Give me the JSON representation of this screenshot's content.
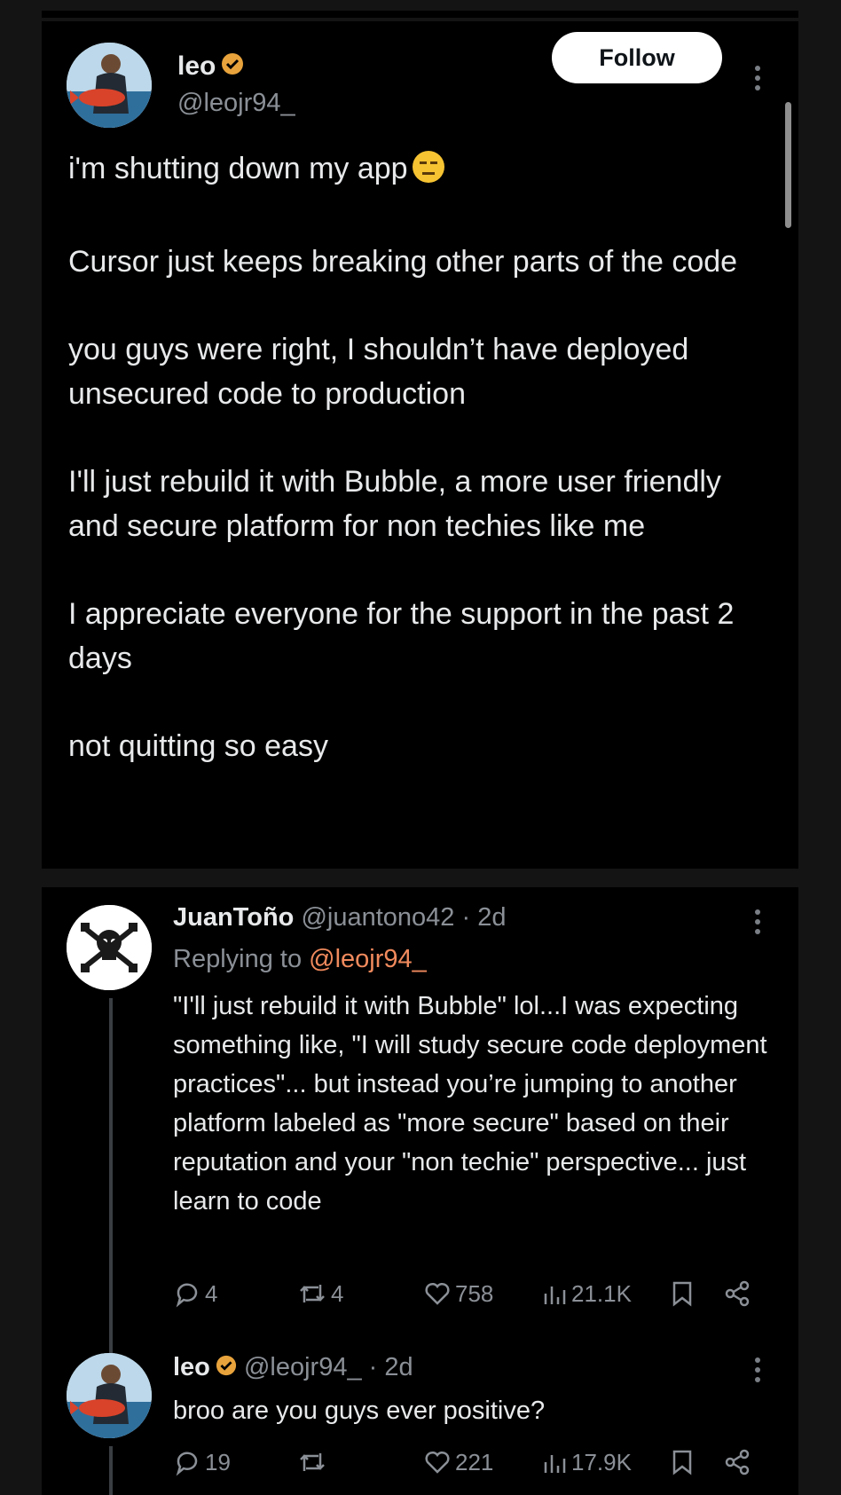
{
  "post": {
    "author_name": "leo",
    "author_handle": "@leojr94_",
    "follow_label": "Follow",
    "paragraphs": [
      "i'm shutting down my app",
      "Cursor just keeps breaking other parts of the code",
      "you guys were right, I shouldn’t have deployed unsecured code to production",
      "I'll just rebuild it with Bubble, a more user friendly and secure platform for non techies like me",
      "I appreciate everyone for the support in the past 2 days",
      "not quitting so easy"
    ]
  },
  "replies": [
    {
      "author_name": "JuanToño",
      "author_handle": "@juantono42",
      "time": "· 2d",
      "replying_prefix": "Replying to",
      "replying_to": "@leojr94_",
      "text": "\"I'll just rebuild it with Bubble\" lol...I was expecting  something like, \"I will study secure code deployment practices\"... but instead you’re jumping to another platform labeled as \"more secure\" based on their reputation and your \"non techie\" perspective... just learn to code",
      "stats": {
        "replies": "4",
        "reposts": "4",
        "likes": "758",
        "views": "21.1K"
      }
    },
    {
      "author_name": "leo",
      "author_handle": "@leojr94_",
      "time": "· 2d",
      "text": "broo are you guys ever positive?",
      "stats": {
        "replies": "19",
        "reposts": "",
        "likes": "221",
        "views": "17.9K"
      }
    }
  ],
  "icons": {
    "verified": "verified-badge-icon",
    "emoji": "expressionless-face-emoji",
    "reply": "reply-icon",
    "repost": "repost-icon",
    "like": "heart-icon",
    "views": "views-icon",
    "bookmark": "bookmark-icon",
    "share": "share-icon",
    "more": "more-vertical-icon"
  },
  "colors": {
    "background": "#000000",
    "text": "#e7e9ea",
    "muted": "#8b9097",
    "verified": "#e8a33c",
    "link": "#f08a5d"
  }
}
